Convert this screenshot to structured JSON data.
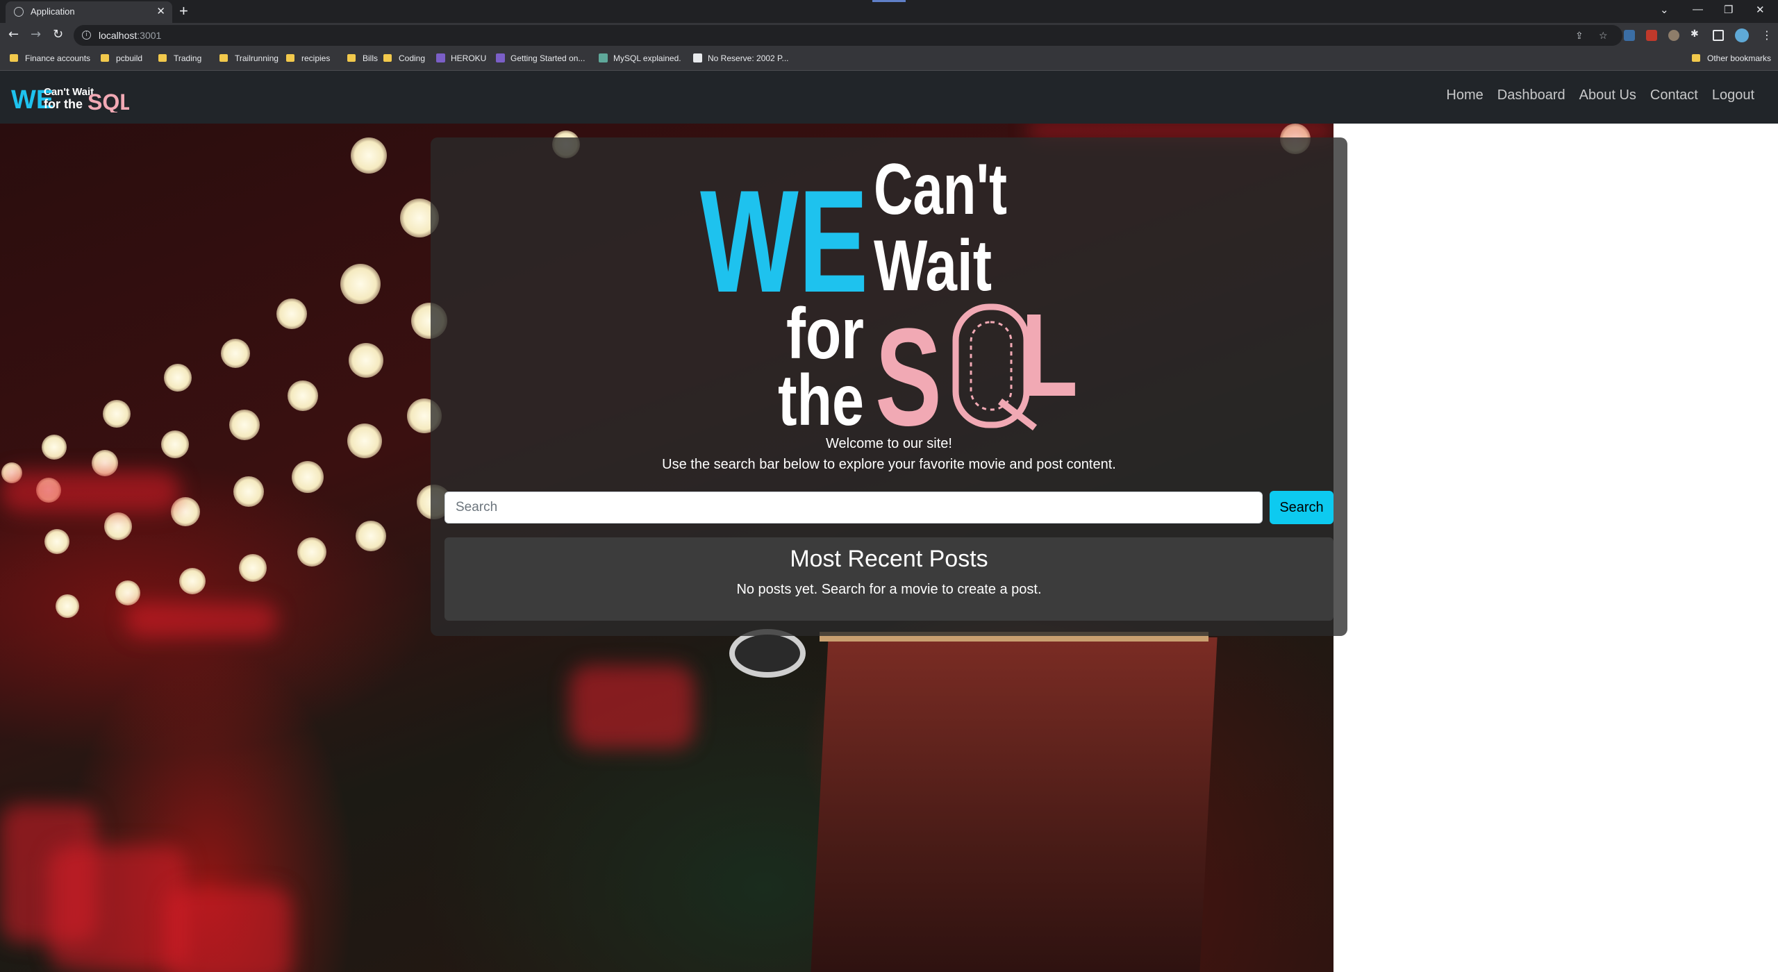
{
  "browser": {
    "tab_title": "Application",
    "tab_close": "✕",
    "new_tab": "+",
    "url_host": "localhost",
    "url_port": ":3001",
    "window_controls": [
      "⌄",
      "—",
      "❐",
      "✕"
    ],
    "bookmarks": [
      {
        "label": "Finance accounts",
        "type": "folder"
      },
      {
        "label": "pcbuild",
        "type": "folder"
      },
      {
        "label": "Trading",
        "type": "folder"
      },
      {
        "label": "Trailrunning",
        "type": "folder"
      },
      {
        "label": "recipies",
        "type": "folder"
      },
      {
        "label": "Bills",
        "type": "folder"
      },
      {
        "label": "Coding",
        "type": "folder"
      },
      {
        "label": "HEROKU",
        "type": "heroku"
      },
      {
        "label": "Getting Started on...",
        "type": "heroku"
      },
      {
        "label": "MySQL explained.",
        "type": "chatgpt"
      },
      {
        "label": "No Reserve: 2002 P...",
        "type": "page"
      }
    ],
    "other_bookmarks": "Other bookmarks"
  },
  "site": {
    "brand": {
      "we": "WE",
      "cant_wait": "Can't Wait",
      "for_the": "for the",
      "sql": "SQL"
    },
    "nav": [
      "Home",
      "Dashboard",
      "About Us",
      "Contact",
      "Logout"
    ],
    "logo": {
      "we": "WE",
      "cant": "Can't",
      "wait": "Wait",
      "for": "for",
      "the": "the",
      "s": "S",
      "l": "L"
    },
    "welcome": "Welcome to our site!",
    "subline": "Use the search bar below to explore your favorite movie and post content.",
    "search": {
      "placeholder": "Search",
      "button": "Search"
    },
    "posts": {
      "title": "Most Recent Posts",
      "empty": "No posts yet. Search for a movie to create a post."
    }
  },
  "colors": {
    "accent_cyan": "#0dcaf0",
    "logo_cyan": "#1ec2ee",
    "logo_pink": "#f1a9b4",
    "navbar": "#212529"
  }
}
